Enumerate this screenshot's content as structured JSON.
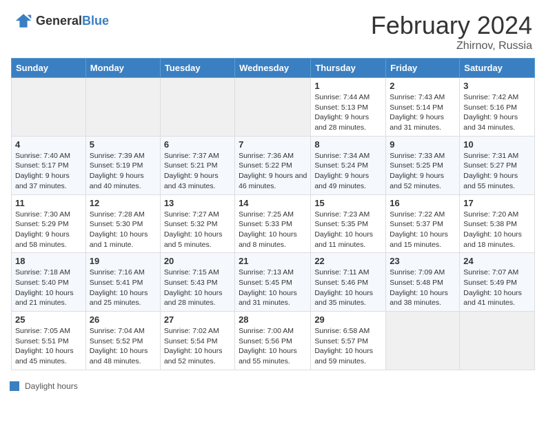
{
  "header": {
    "logo_general": "General",
    "logo_blue": "Blue",
    "title": "February 2024",
    "location": "Zhirnov, Russia"
  },
  "days_of_week": [
    "Sunday",
    "Monday",
    "Tuesday",
    "Wednesday",
    "Thursday",
    "Friday",
    "Saturday"
  ],
  "legend_label": "Daylight hours",
  "weeks": [
    [
      {
        "day": "",
        "info": ""
      },
      {
        "day": "",
        "info": ""
      },
      {
        "day": "",
        "info": ""
      },
      {
        "day": "",
        "info": ""
      },
      {
        "day": "1",
        "info": "Sunrise: 7:44 AM\nSunset: 5:13 PM\nDaylight: 9 hours and 28 minutes."
      },
      {
        "day": "2",
        "info": "Sunrise: 7:43 AM\nSunset: 5:14 PM\nDaylight: 9 hours and 31 minutes."
      },
      {
        "day": "3",
        "info": "Sunrise: 7:42 AM\nSunset: 5:16 PM\nDaylight: 9 hours and 34 minutes."
      }
    ],
    [
      {
        "day": "4",
        "info": "Sunrise: 7:40 AM\nSunset: 5:17 PM\nDaylight: 9 hours and 37 minutes."
      },
      {
        "day": "5",
        "info": "Sunrise: 7:39 AM\nSunset: 5:19 PM\nDaylight: 9 hours and 40 minutes."
      },
      {
        "day": "6",
        "info": "Sunrise: 7:37 AM\nSunset: 5:21 PM\nDaylight: 9 hours and 43 minutes."
      },
      {
        "day": "7",
        "info": "Sunrise: 7:36 AM\nSunset: 5:22 PM\nDaylight: 9 hours and 46 minutes."
      },
      {
        "day": "8",
        "info": "Sunrise: 7:34 AM\nSunset: 5:24 PM\nDaylight: 9 hours and 49 minutes."
      },
      {
        "day": "9",
        "info": "Sunrise: 7:33 AM\nSunset: 5:25 PM\nDaylight: 9 hours and 52 minutes."
      },
      {
        "day": "10",
        "info": "Sunrise: 7:31 AM\nSunset: 5:27 PM\nDaylight: 9 hours and 55 minutes."
      }
    ],
    [
      {
        "day": "11",
        "info": "Sunrise: 7:30 AM\nSunset: 5:29 PM\nDaylight: 9 hours and 58 minutes."
      },
      {
        "day": "12",
        "info": "Sunrise: 7:28 AM\nSunset: 5:30 PM\nDaylight: 10 hours and 1 minute."
      },
      {
        "day": "13",
        "info": "Sunrise: 7:27 AM\nSunset: 5:32 PM\nDaylight: 10 hours and 5 minutes."
      },
      {
        "day": "14",
        "info": "Sunrise: 7:25 AM\nSunset: 5:33 PM\nDaylight: 10 hours and 8 minutes."
      },
      {
        "day": "15",
        "info": "Sunrise: 7:23 AM\nSunset: 5:35 PM\nDaylight: 10 hours and 11 minutes."
      },
      {
        "day": "16",
        "info": "Sunrise: 7:22 AM\nSunset: 5:37 PM\nDaylight: 10 hours and 15 minutes."
      },
      {
        "day": "17",
        "info": "Sunrise: 7:20 AM\nSunset: 5:38 PM\nDaylight: 10 hours and 18 minutes."
      }
    ],
    [
      {
        "day": "18",
        "info": "Sunrise: 7:18 AM\nSunset: 5:40 PM\nDaylight: 10 hours and 21 minutes."
      },
      {
        "day": "19",
        "info": "Sunrise: 7:16 AM\nSunset: 5:41 PM\nDaylight: 10 hours and 25 minutes."
      },
      {
        "day": "20",
        "info": "Sunrise: 7:15 AM\nSunset: 5:43 PM\nDaylight: 10 hours and 28 minutes."
      },
      {
        "day": "21",
        "info": "Sunrise: 7:13 AM\nSunset: 5:45 PM\nDaylight: 10 hours and 31 minutes."
      },
      {
        "day": "22",
        "info": "Sunrise: 7:11 AM\nSunset: 5:46 PM\nDaylight: 10 hours and 35 minutes."
      },
      {
        "day": "23",
        "info": "Sunrise: 7:09 AM\nSunset: 5:48 PM\nDaylight: 10 hours and 38 minutes."
      },
      {
        "day": "24",
        "info": "Sunrise: 7:07 AM\nSunset: 5:49 PM\nDaylight: 10 hours and 41 minutes."
      }
    ],
    [
      {
        "day": "25",
        "info": "Sunrise: 7:05 AM\nSunset: 5:51 PM\nDaylight: 10 hours and 45 minutes."
      },
      {
        "day": "26",
        "info": "Sunrise: 7:04 AM\nSunset: 5:52 PM\nDaylight: 10 hours and 48 minutes."
      },
      {
        "day": "27",
        "info": "Sunrise: 7:02 AM\nSunset: 5:54 PM\nDaylight: 10 hours and 52 minutes."
      },
      {
        "day": "28",
        "info": "Sunrise: 7:00 AM\nSunset: 5:56 PM\nDaylight: 10 hours and 55 minutes."
      },
      {
        "day": "29",
        "info": "Sunrise: 6:58 AM\nSunset: 5:57 PM\nDaylight: 10 hours and 59 minutes."
      },
      {
        "day": "",
        "info": ""
      },
      {
        "day": "",
        "info": ""
      }
    ]
  ]
}
